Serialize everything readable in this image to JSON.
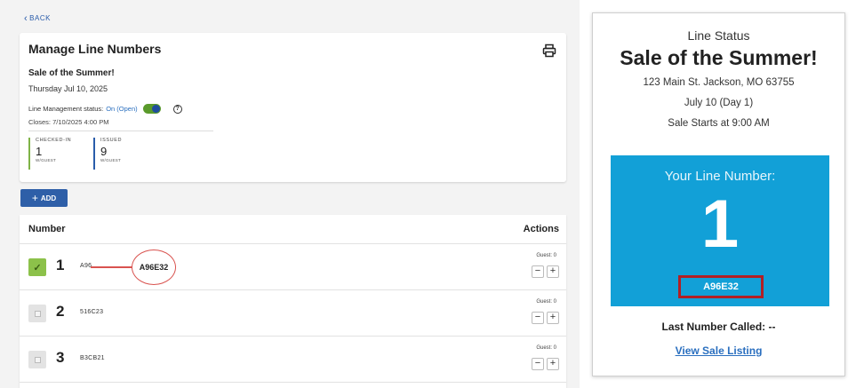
{
  "back_label": "BACK",
  "manage": {
    "title": "Manage Line Numbers",
    "sale_name": "Sale of the Summer!",
    "date": "Thursday Jul 10, 2025",
    "status_label": "Line Management status:",
    "status_value": "On (Open)",
    "closes": "Closes: 7/10/2025 4:00 PM",
    "checked_in": {
      "label": "CHECKED-IN",
      "value": "1",
      "sub": "W/GUEST"
    },
    "issued": {
      "label": "ISSUED",
      "value": "9",
      "sub": "W/GUEST"
    }
  },
  "add_label": "ADD",
  "table": {
    "col_number": "Number",
    "col_actions": "Actions",
    "rows": [
      {
        "number": "1",
        "code": "A96",
        "guest": "Guest: 0",
        "checked": true,
        "callout": "A96E32"
      },
      {
        "number": "2",
        "code": "516C23",
        "guest": "Guest: 0",
        "checked": false
      },
      {
        "number": "3",
        "code": "B3CB21",
        "guest": "Guest: 0",
        "checked": false
      }
    ]
  },
  "status_card": {
    "heading": "Line Status",
    "title": "Sale of the Summer!",
    "address": "123 Main St. Jackson, MO 63755",
    "day": "July 10 (Day 1)",
    "starts": "Sale Starts at 9:00 AM",
    "your_line_label": "Your Line Number:",
    "line_number": "1",
    "code": "A96E32",
    "last_called": "Last Number Called: --",
    "link": "View Sale Listing"
  }
}
